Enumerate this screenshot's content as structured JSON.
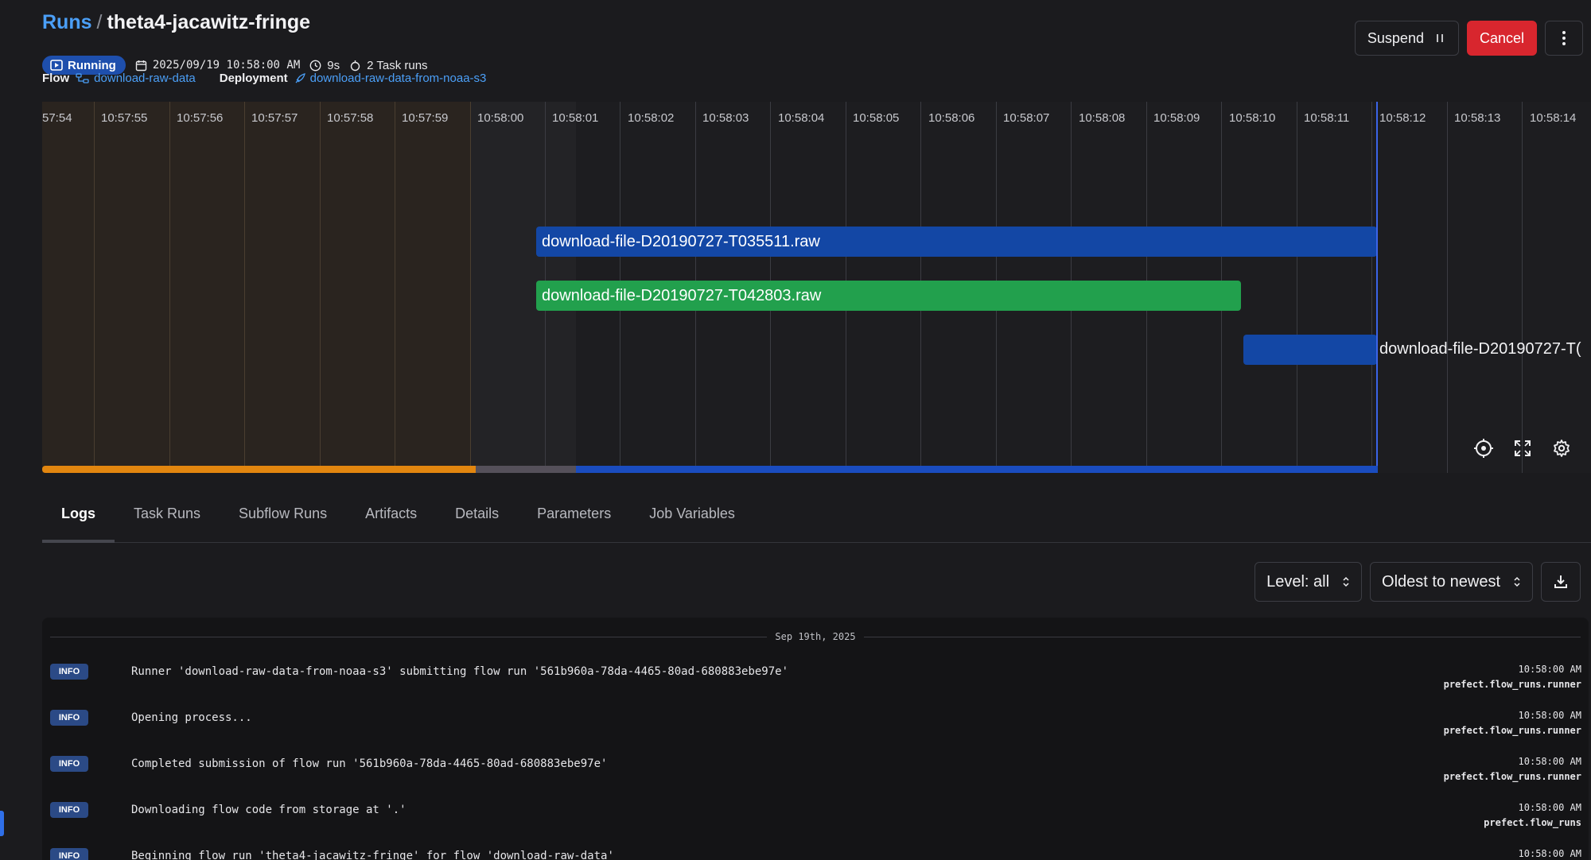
{
  "breadcrumb": {
    "parent": "Runs",
    "separator": "/",
    "current": "theta4-jacawitz-fringe"
  },
  "run": {
    "state": "Running",
    "start": "2025/09/19 10:58:00 AM",
    "duration": "9s",
    "task_runs": "2 Task runs",
    "flow_label": "Flow",
    "flow_name": "download-raw-data",
    "deployment_label": "Deployment",
    "deployment_name": "download-raw-data-from-noaa-s3"
  },
  "actions": {
    "suspend": "Suspend",
    "cancel": "Cancel"
  },
  "timeline": {
    "ticks": [
      "57:54",
      "10:57:55",
      "10:57:56",
      "10:57:57",
      "10:57:58",
      "10:57:59",
      "10:58:00",
      "10:58:01",
      "10:58:02",
      "10:58:03",
      "10:58:04",
      "10:58:05",
      "10:58:06",
      "10:58:07",
      "10:58:08",
      "10:58:09",
      "10:58:10",
      "10:58:11",
      "10:58:12",
      "10:58:13",
      "10:58:14"
    ],
    "bars": [
      {
        "label": "download-file-D20190727-T035511.raw",
        "state": "running"
      },
      {
        "label": "download-file-D20190727-T042803.raw",
        "state": "completed"
      },
      {
        "label": "download-file-D20190727-T(",
        "state": "running"
      }
    ]
  },
  "tabs": [
    "Logs",
    "Task Runs",
    "Subflow Runs",
    "Artifacts",
    "Details",
    "Parameters",
    "Job Variables"
  ],
  "log_controls": {
    "level": "Level: all",
    "order": "Oldest to newest"
  },
  "logs": {
    "date": "Sep 19th, 2025",
    "entries": [
      {
        "level": "INFO",
        "message": "Runner 'download-raw-data-from-noaa-s3' submitting flow run '561b960a-78da-4465-80ad-680883ebe97e'",
        "time": "10:58:00 AM",
        "logger": "prefect.flow_runs.runner"
      },
      {
        "level": "INFO",
        "message": "Opening process...",
        "time": "10:58:00 AM",
        "logger": "prefect.flow_runs.runner"
      },
      {
        "level": "INFO",
        "message": "Completed submission of flow run '561b960a-78da-4465-80ad-680883ebe97e'",
        "time": "10:58:00 AM",
        "logger": "prefect.flow_runs.runner"
      },
      {
        "level": "INFO",
        "message": "Downloading flow code from storage at '.'",
        "time": "10:58:00 AM",
        "logger": "prefect.flow_runs"
      },
      {
        "level": "INFO",
        "message": "Beginning flow run 'theta4-jacawitz-fringe' for flow 'download-raw-data'",
        "time": "10:58:00 AM",
        "logger": ""
      }
    ]
  },
  "colors": {
    "accent_link": "#4b9ff7",
    "running": "#1347a5",
    "completed": "#22a04d",
    "danger": "#d8262e",
    "scheduled": "#e2860f",
    "background": "#1b1b1e"
  }
}
